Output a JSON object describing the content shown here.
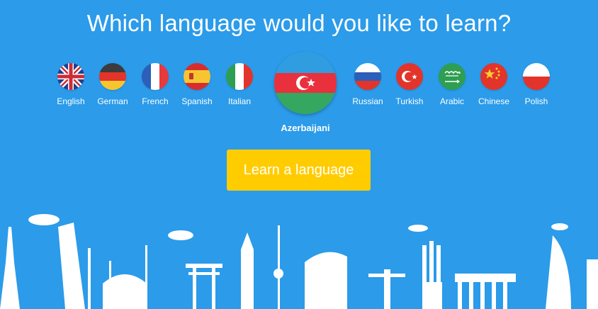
{
  "header": {
    "title": "Which language would you like to learn?"
  },
  "languages": [
    {
      "label": "English",
      "icon": "uk-flag-icon"
    },
    {
      "label": "German",
      "icon": "german-flag-icon"
    },
    {
      "label": "French",
      "icon": "french-flag-icon"
    },
    {
      "label": "Spanish",
      "icon": "spanish-flag-icon"
    },
    {
      "label": "Italian",
      "icon": "italian-flag-icon"
    },
    {
      "label": "Azerbaijani",
      "icon": "azerbaijan-flag-icon",
      "selected": true
    },
    {
      "label": "Russian",
      "icon": "russian-flag-icon"
    },
    {
      "label": "Turkish",
      "icon": "turkish-flag-icon"
    },
    {
      "label": "Arabic",
      "icon": "saudi-flag-icon"
    },
    {
      "label": "Chinese",
      "icon": "chinese-flag-icon"
    },
    {
      "label": "Polish",
      "icon": "polish-flag-icon"
    }
  ],
  "cta": {
    "label": "Learn a language"
  },
  "colors": {
    "background": "#2b9bea",
    "button": "#ffcc00",
    "text": "#ffffff"
  }
}
